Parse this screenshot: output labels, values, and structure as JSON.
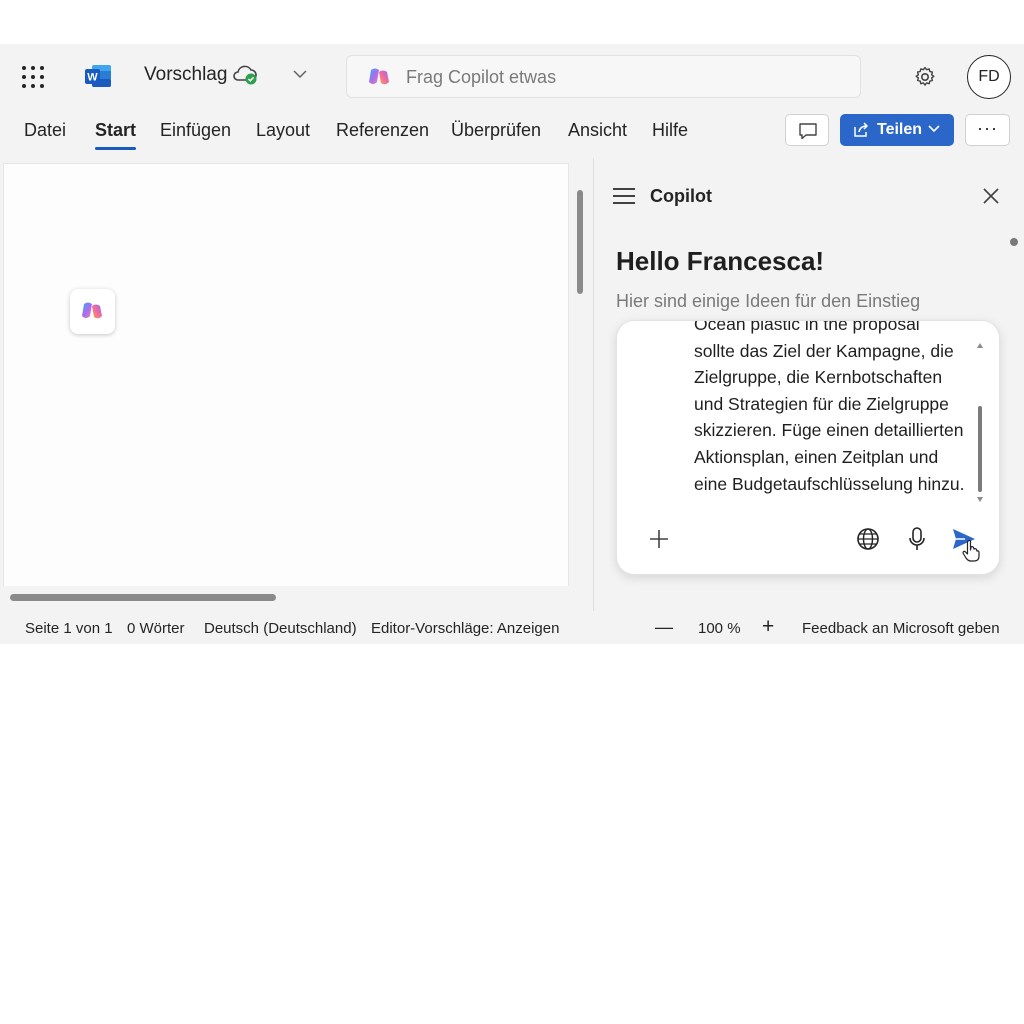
{
  "app": {
    "doc_title": "Vorschlag",
    "search_placeholder": "Frag Copilot etwas",
    "user_initials": "FD"
  },
  "ribbon": {
    "tabs": [
      "Datei",
      "Start",
      "Einfügen",
      "Layout",
      "Referenzen",
      "Überprüfen",
      "Ansicht",
      "Hilfe"
    ],
    "active_tab": "Start",
    "share_label": "Teilen",
    "more_label": "···"
  },
  "copilot": {
    "title": "Copilot",
    "greeting": "Hello Francesca!",
    "subtitle": "Hier sind einige Ideen für den Einstieg",
    "message_partial_line": "Ocean plastic in the proposal",
    "message_lines": [
      "sollte das Ziel der Kampagne, die",
      "Zielgruppe, die Kernbotschaften",
      "und Strategien für die Zielgruppe",
      "skizzieren. Füge einen detaillierten",
      "Aktionsplan, einen Zeitplan und",
      "eine Budgetaufschlüsselung hinzu."
    ]
  },
  "status": {
    "page": "Seite 1 von 1",
    "words": "0 Wörter",
    "language": "Deutsch (Deutschland)",
    "editor": "Editor-Vorschläge: Anzeigen",
    "zoom_out": "—",
    "zoom": "100 %",
    "zoom_in": "+",
    "feedback": "Feedback an Microsoft geben"
  },
  "colors": {
    "accent": "#2b66c9",
    "active_tab_underline": "#185abd",
    "sync_ok": "#2e9e4f"
  }
}
